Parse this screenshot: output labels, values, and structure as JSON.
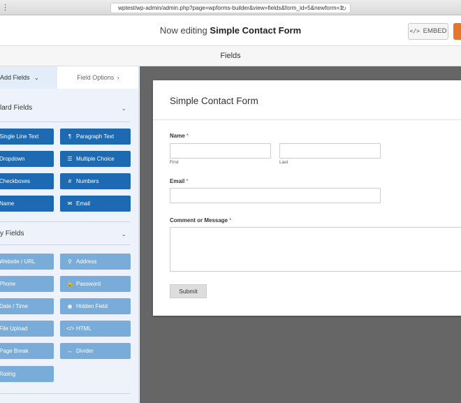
{
  "browser": {
    "url": "wptest/wp-admin/admin.php?page=wpforms-builder&view=fields&form_id=5&newform=1",
    "reload_icon": "reload-icon"
  },
  "header": {
    "editing_prefix": "Now editing",
    "form_name": "Simple Contact Form",
    "embed_label": "EMBED",
    "accent_color": "#e27730"
  },
  "section": {
    "title": "Fields"
  },
  "sidebar": {
    "tabs": {
      "add_fields": "Add Fields",
      "field_options": "Field Options"
    },
    "standard_group": {
      "title": "lard Fields",
      "buttons": [
        {
          "label": "Single Line Text",
          "icon": "text-icon"
        },
        {
          "label": "Paragraph Text",
          "icon": "paragraph-icon",
          "glyph": "¶"
        },
        {
          "label": "Dropdown",
          "icon": "dropdown-icon"
        },
        {
          "label": "Multiple Choice",
          "icon": "list-icon",
          "glyph": "☰"
        },
        {
          "label": "Checkboxes",
          "icon": "checkbox-icon"
        },
        {
          "label": "Numbers",
          "icon": "hash-icon",
          "glyph": "#"
        },
        {
          "label": "Name",
          "icon": "user-icon"
        },
        {
          "label": "Email",
          "icon": "envelope-icon",
          "glyph": "✉"
        }
      ]
    },
    "fancy_group": {
      "title": "y Fields",
      "buttons": [
        {
          "label": "Website / URL",
          "icon": "link-icon"
        },
        {
          "label": "Address",
          "icon": "map-pin-icon",
          "glyph": "⚲"
        },
        {
          "label": "Phone",
          "icon": "phone-icon"
        },
        {
          "label": "Password",
          "icon": "lock-icon",
          "glyph": "🔒"
        },
        {
          "label": "Date / Time",
          "icon": "calendar-icon"
        },
        {
          "label": "Hidden Field",
          "icon": "eye-slash-icon",
          "glyph": "◉"
        },
        {
          "label": "File Upload",
          "icon": "upload-icon"
        },
        {
          "label": "HTML",
          "icon": "code-icon",
          "glyph": "</>"
        },
        {
          "label": "Page Break",
          "icon": "page-break-icon"
        },
        {
          "label": "Divider",
          "icon": "arrows-h-icon",
          "glyph": "↔"
        },
        {
          "label": "Rating",
          "icon": "star-icon"
        }
      ]
    },
    "colors": {
      "standard": "#1e6ab2",
      "fancy": "#79acd8"
    }
  },
  "form": {
    "title": "Simple Contact Form",
    "fields": {
      "name_label": "Name",
      "first_sublabel": "First",
      "last_sublabel": "Last",
      "email_label": "Email",
      "message_label": "Comment or Message",
      "required_mark": "*"
    },
    "submit_label": "Submit"
  }
}
